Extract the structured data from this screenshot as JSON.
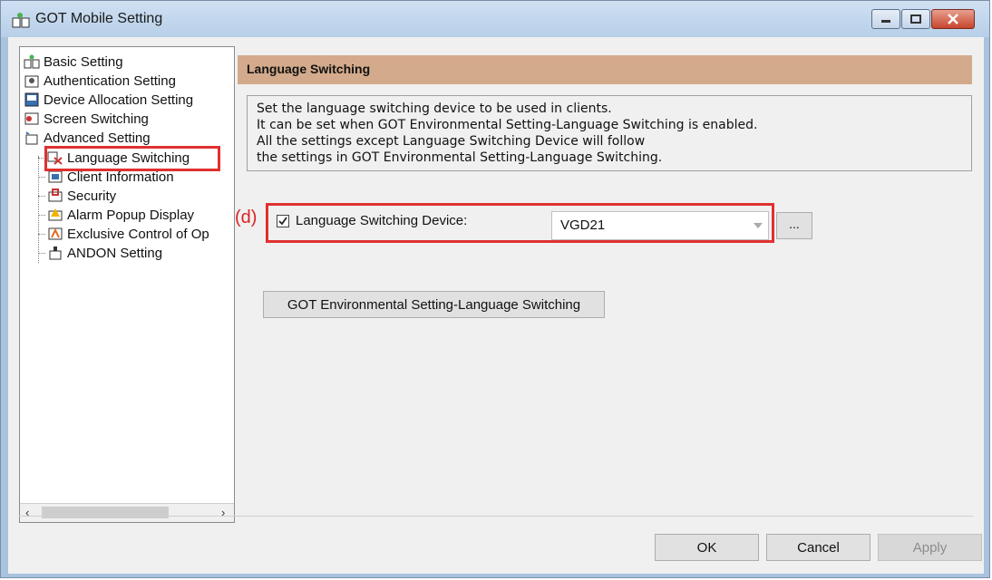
{
  "window": {
    "title": "GOT Mobile Setting"
  },
  "tree": {
    "items": [
      {
        "label": "Basic Setting",
        "icon": "basic-setting-icon"
      },
      {
        "label": "Authentication Setting",
        "icon": "authentication-icon"
      },
      {
        "label": "Device Allocation Setting",
        "icon": "device-allocation-icon"
      },
      {
        "label": "Screen Switching",
        "icon": "screen-switching-icon"
      },
      {
        "label": "Advanced Setting",
        "icon": "advanced-setting-icon"
      },
      {
        "label": "Language Switching",
        "icon": "language-switching-icon"
      },
      {
        "label": "Client Information",
        "icon": "client-information-icon"
      },
      {
        "label": "Security",
        "icon": "security-icon"
      },
      {
        "label": "Alarm Popup Display",
        "icon": "alarm-popup-icon"
      },
      {
        "label": "Exclusive Control of Op",
        "icon": "exclusive-control-icon"
      },
      {
        "label": "ANDON Setting",
        "icon": "andon-icon"
      }
    ],
    "selected": "Language Switching"
  },
  "section": {
    "title": "Language Switching",
    "description": [
      "Set the language switching device to be used in clients.",
      "It can be set when GOT Environmental Setting-Language Switching is enabled.",
      "All the settings except Language Switching Device will follow",
      "the settings in GOT Environmental Setting-Language Switching."
    ]
  },
  "annotation": {
    "marker": "(d)"
  },
  "device": {
    "checkbox_checked": true,
    "label": "Language Switching Device:",
    "value": "VGD21",
    "browse_label": "..."
  },
  "env_button_label": "GOT Environmental Setting-Language Switching",
  "footer": {
    "ok": "OK",
    "cancel": "Cancel",
    "apply": "Apply"
  },
  "colors": {
    "section_header": "#d3aa8b",
    "highlight": "#e03030",
    "title_bar": "#b7cfe8"
  }
}
